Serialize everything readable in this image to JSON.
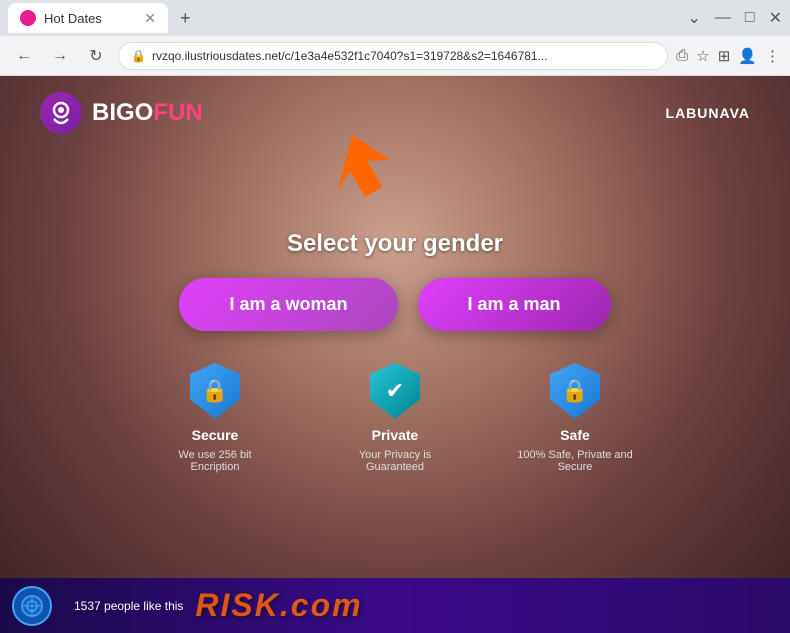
{
  "browser": {
    "tab_title": "Hot Dates",
    "address": "rvzqo.ilustriousdates.net/c/1e3a4e532f1c7040?s1=319728&s2=1646781...",
    "nav_back": "←",
    "nav_forward": "→",
    "nav_refresh": "↻"
  },
  "header": {
    "logo_bigo": "BIGO",
    "logo_fun": "FUN",
    "nav_link": "LABUNAVA"
  },
  "main": {
    "select_gender_title": "Select your gender",
    "btn_woman": "I am a woman",
    "btn_man": "I am a man"
  },
  "badges": [
    {
      "title": "Secure",
      "desc": "We use 256 bit Encription",
      "icon": "🔒",
      "color": "shield-blue"
    },
    {
      "title": "Private",
      "desc": "Your Privacy is Guaranteed",
      "icon": "✔",
      "color": "shield-teal"
    },
    {
      "title": "Safe",
      "desc": "100% Safe, Private and Secure",
      "icon": "🔒",
      "color": "shield-blue"
    }
  ],
  "bottom_bar": {
    "people_text": "1537 people like this",
    "risk_text": "RISK.com"
  }
}
